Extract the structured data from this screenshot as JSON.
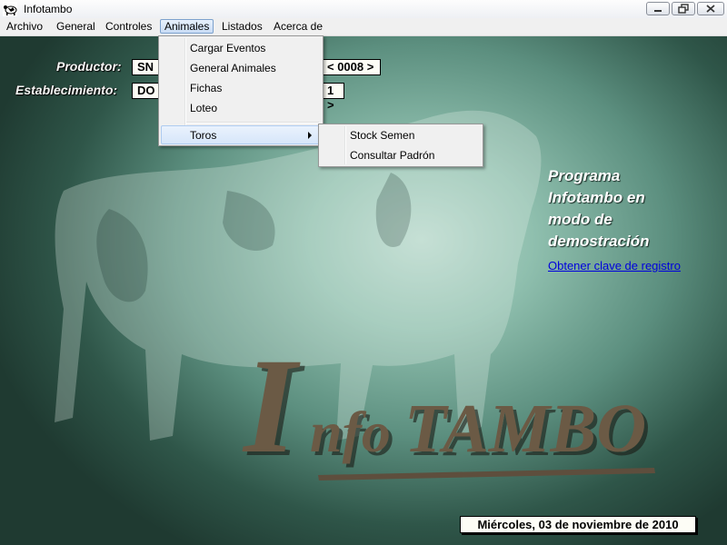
{
  "window": {
    "title": "Infotambo",
    "icon": "cow-app-icon"
  },
  "menubar": {
    "items": [
      "Archivo",
      "General",
      "Controles",
      "Animales",
      "Listados",
      "Acerca de"
    ],
    "active": "Animales"
  },
  "animales_menu": {
    "items": [
      "Cargar Eventos",
      "General Animales",
      "Fichas",
      "Loteo",
      "Toros"
    ],
    "hovered": "Toros"
  },
  "toros_submenu": {
    "items": [
      "Stock Semen",
      "Consultar Padrón"
    ]
  },
  "form": {
    "productor_label": "Productor:",
    "productor_value": "SN",
    "productor_code": "< 0008 >",
    "establecimiento_label": "Establecimiento:",
    "establecimiento_value": "DO",
    "establecimiento_code": "1 >"
  },
  "demo": {
    "lines": [
      "Programa",
      "Infotambo en",
      "modo de",
      "demostración"
    ],
    "link": "Obtener clave de registro"
  },
  "logo": {
    "text": "InfoTAMBO"
  },
  "status": {
    "date": "Miércoles, 03 de noviembre de 2010"
  },
  "colors": {
    "link": "#0000dd",
    "menu_highlight": "#d6e6fa",
    "logo": "#6b5a45"
  }
}
